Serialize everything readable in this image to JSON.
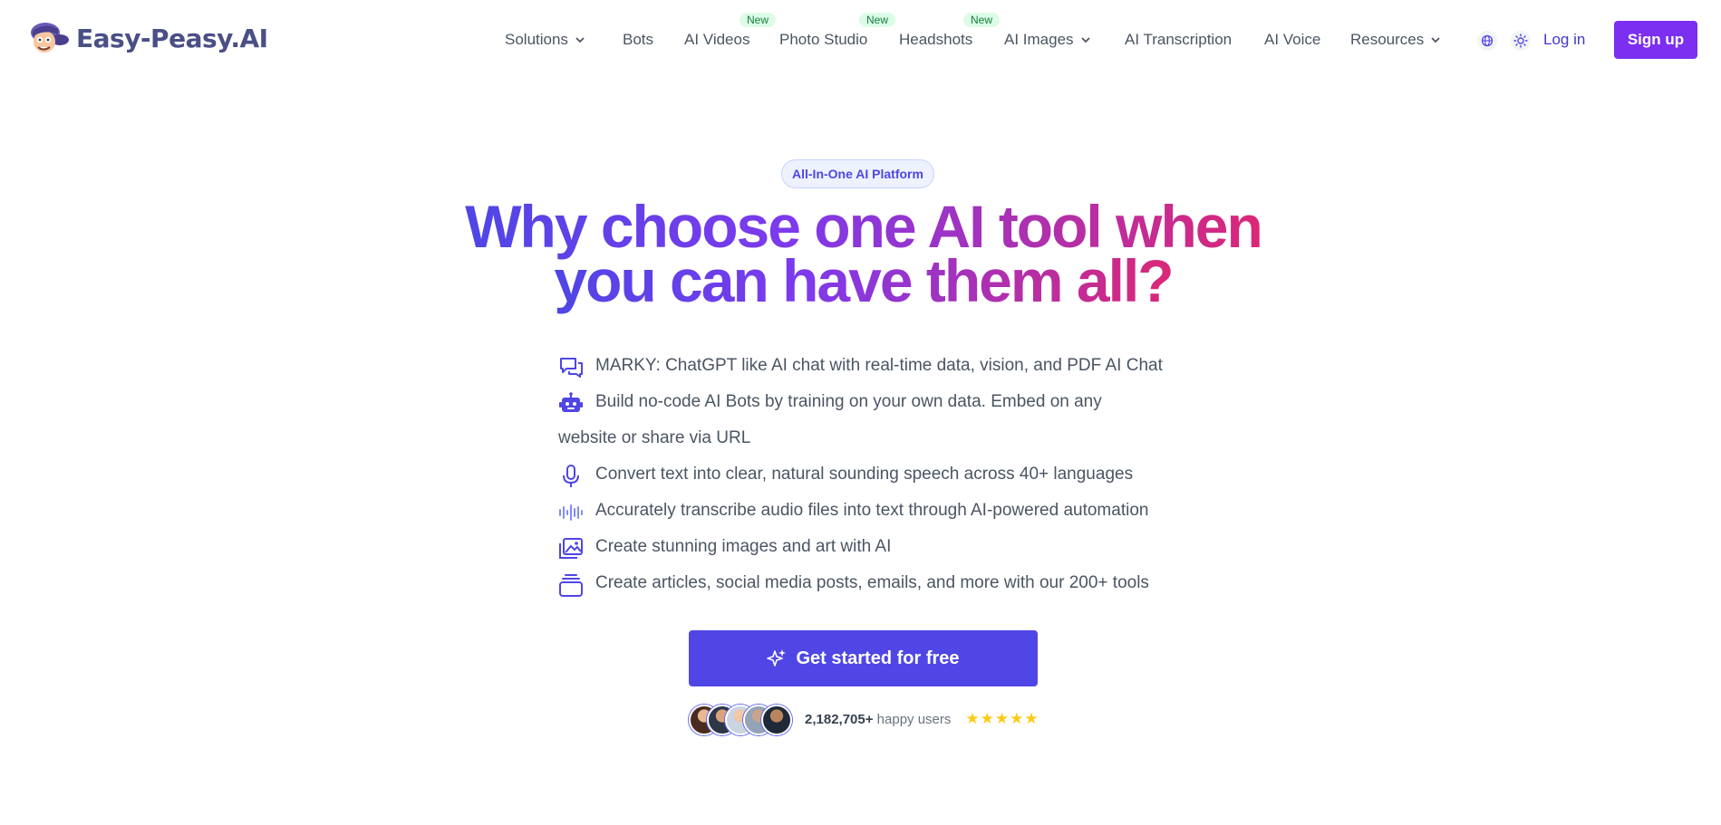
{
  "brand": {
    "name": "Easy-Peasy.AI"
  },
  "nav": {
    "items": [
      {
        "label": "Solutions",
        "dropdown": true,
        "badge": ""
      },
      {
        "label": "Bots",
        "dropdown": false,
        "badge": ""
      },
      {
        "label": "AI Videos",
        "dropdown": false,
        "badge": "New"
      },
      {
        "label": "Photo Studio",
        "dropdown": false,
        "badge": "New"
      },
      {
        "label": "Headshots",
        "dropdown": false,
        "badge": "New"
      },
      {
        "label": "AI Images",
        "dropdown": true,
        "badge": ""
      },
      {
        "label": "AI Transcription",
        "dropdown": false,
        "badge": ""
      },
      {
        "label": "AI Voice",
        "dropdown": false,
        "badge": ""
      },
      {
        "label": "Resources",
        "dropdown": true,
        "badge": ""
      }
    ],
    "language_icon": "globe-icon",
    "theme_icon": "sun-icon",
    "login": "Log in",
    "signup": "Sign up"
  },
  "hero": {
    "pill": "All-In-One AI Platform",
    "headline_line1": "Why choose one AI tool when",
    "headline_line2": "you can have them all?",
    "features": [
      {
        "icon": "chat-icon",
        "text": "MARKY: ChatGPT like AI chat with real-time data, vision, and PDF AI Chat"
      },
      {
        "icon": "robot-icon",
        "text": "Build no-code AI Bots by training on your own data. Embed on any",
        "text2": "website or share via URL"
      },
      {
        "icon": "microphone-icon",
        "text": "Convert text into clear, natural sounding speech across 40+ languages"
      },
      {
        "icon": "waveform-icon",
        "text": "Accurately transcribe audio files into text through AI-powered automation"
      },
      {
        "icon": "images-icon",
        "text": "Create stunning images and art with AI"
      },
      {
        "icon": "stack-icon",
        "text": "Create articles, social media posts, emails, and more with our 200+ tools"
      }
    ],
    "cta": "Get started for free",
    "users_count": "2,182,705+",
    "users_label": "happy users",
    "rating_stars": 5
  },
  "colors": {
    "primary": "#4f46e5",
    "signup": "#7c2ff0",
    "gradient_start": "#4f46e5",
    "gradient_end": "#db2777",
    "star": "#facc15"
  }
}
